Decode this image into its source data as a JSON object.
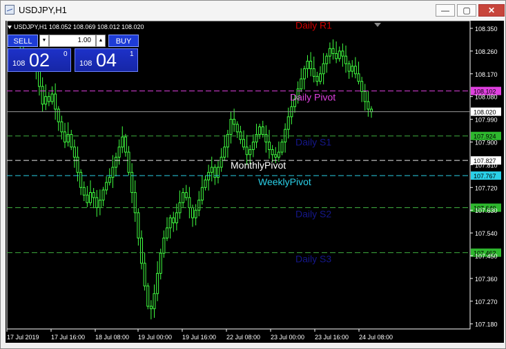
{
  "window": {
    "title": "USDJPY,H1",
    "minimize_label": "—",
    "maximize_label": "▢",
    "close_label": "✕"
  },
  "chart_header": {
    "symbol_info": "USDJPY,H1  108.052 108.069 108.012 108.020"
  },
  "trade_panel": {
    "sell_label": "SELL",
    "buy_label": "BUY",
    "lot_value": "1.00",
    "sell_price": {
      "prefix": "108",
      "big": "02",
      "sup": "0"
    },
    "buy_price": {
      "prefix": "108",
      "big": "04",
      "sup": "1"
    }
  },
  "chart_data": {
    "type": "candlestick",
    "symbol": "USDJPY",
    "timeframe": "H1",
    "current_price": 108.02,
    "y_ticks": [
      "108.350",
      "108.260",
      "108.170",
      "108.080",
      "107.990",
      "107.900",
      "107.810",
      "107.720",
      "107.630",
      "107.540",
      "107.450",
      "107.360",
      "107.270",
      "107.180"
    ],
    "x_ticks": [
      "17 Jul 2019",
      "17 Jul 16:00",
      "18 Jul 08:00",
      "19 Jul 00:00",
      "19 Jul 16:00",
      "22 Jul 08:00",
      "23 Jul 00:00",
      "23 Jul 16:00",
      "24 Jul 08:00"
    ],
    "levels": [
      {
        "name": "Daily R1",
        "value": 108.36,
        "color": "#d00000",
        "label_color": "#d00000",
        "show_tag": false,
        "tag": ""
      },
      {
        "name": "Daily Pivot",
        "value": 108.102,
        "color": "#e040e0",
        "label_color": "#e040e0",
        "show_tag": true,
        "tag": "108.102"
      },
      {
        "name": "Daily S1",
        "value": 107.924,
        "color": "#3fae3f",
        "label_color": "#15178a",
        "show_tag": true,
        "tag": "107.924"
      },
      {
        "name": "MonthlyPivot",
        "value": 107.827,
        "color": "#e8e8e8",
        "label_color": "#ffffff",
        "show_tag": true,
        "tag": "107.827"
      },
      {
        "name": "WeeklyPivot",
        "value": 107.767,
        "color": "#2ad0e8",
        "label_color": "#2ad0e8",
        "show_tag": true,
        "tag": "107.767"
      },
      {
        "name": "Daily S2",
        "value": 107.64,
        "color": "#3fae3f",
        "label_color": "#15178a",
        "show_tag": true,
        "tag": "107.640"
      },
      {
        "name": "Daily S3",
        "value": 107.462,
        "color": "#3fae3f",
        "label_color": "#15178a",
        "show_tag": true,
        "tag": "107.462"
      }
    ],
    "current_tag": "108.020",
    "colors": {
      "candle": "#40ff40",
      "grid_text": "#ffffff",
      "background": "#000000"
    },
    "close_path": [
      108.22,
      108.24,
      108.23,
      108.25,
      108.22,
      108.2,
      108.21,
      108.19,
      108.12,
      108.05,
      108.08,
      108.06,
      108.09,
      108.03,
      107.98,
      107.94,
      107.9,
      107.93,
      107.88,
      107.84,
      107.78,
      107.72,
      107.69,
      107.66,
      107.7,
      107.68,
      107.64,
      107.67,
      107.71,
      107.74,
      107.76,
      107.8,
      107.84,
      107.88,
      107.92,
      107.86,
      107.78,
      107.7,
      107.62,
      107.52,
      107.42,
      107.33,
      107.25,
      107.24,
      107.3,
      107.38,
      107.46,
      107.52,
      107.56,
      107.6,
      107.58,
      107.62,
      107.66,
      107.7,
      107.68,
      107.64,
      107.6,
      107.63,
      107.67,
      107.72,
      107.75,
      107.78,
      107.8,
      107.76,
      107.8,
      107.84,
      107.88,
      107.93,
      107.99,
      107.97,
      107.94,
      107.91,
      107.88,
      107.85,
      107.87,
      107.9,
      107.93,
      107.96,
      107.93,
      107.9,
      107.87,
      107.85,
      107.84,
      107.86,
      107.9,
      107.95,
      108.0,
      108.04,
      108.07,
      108.11,
      108.15,
      108.19,
      108.22,
      108.19,
      108.16,
      108.14,
      108.17,
      108.21,
      108.24,
      108.27,
      108.25,
      108.23,
      108.26,
      108.24,
      108.21,
      108.18,
      108.2,
      108.17,
      108.14,
      108.1,
      108.06,
      108.03,
      108.02
    ]
  }
}
